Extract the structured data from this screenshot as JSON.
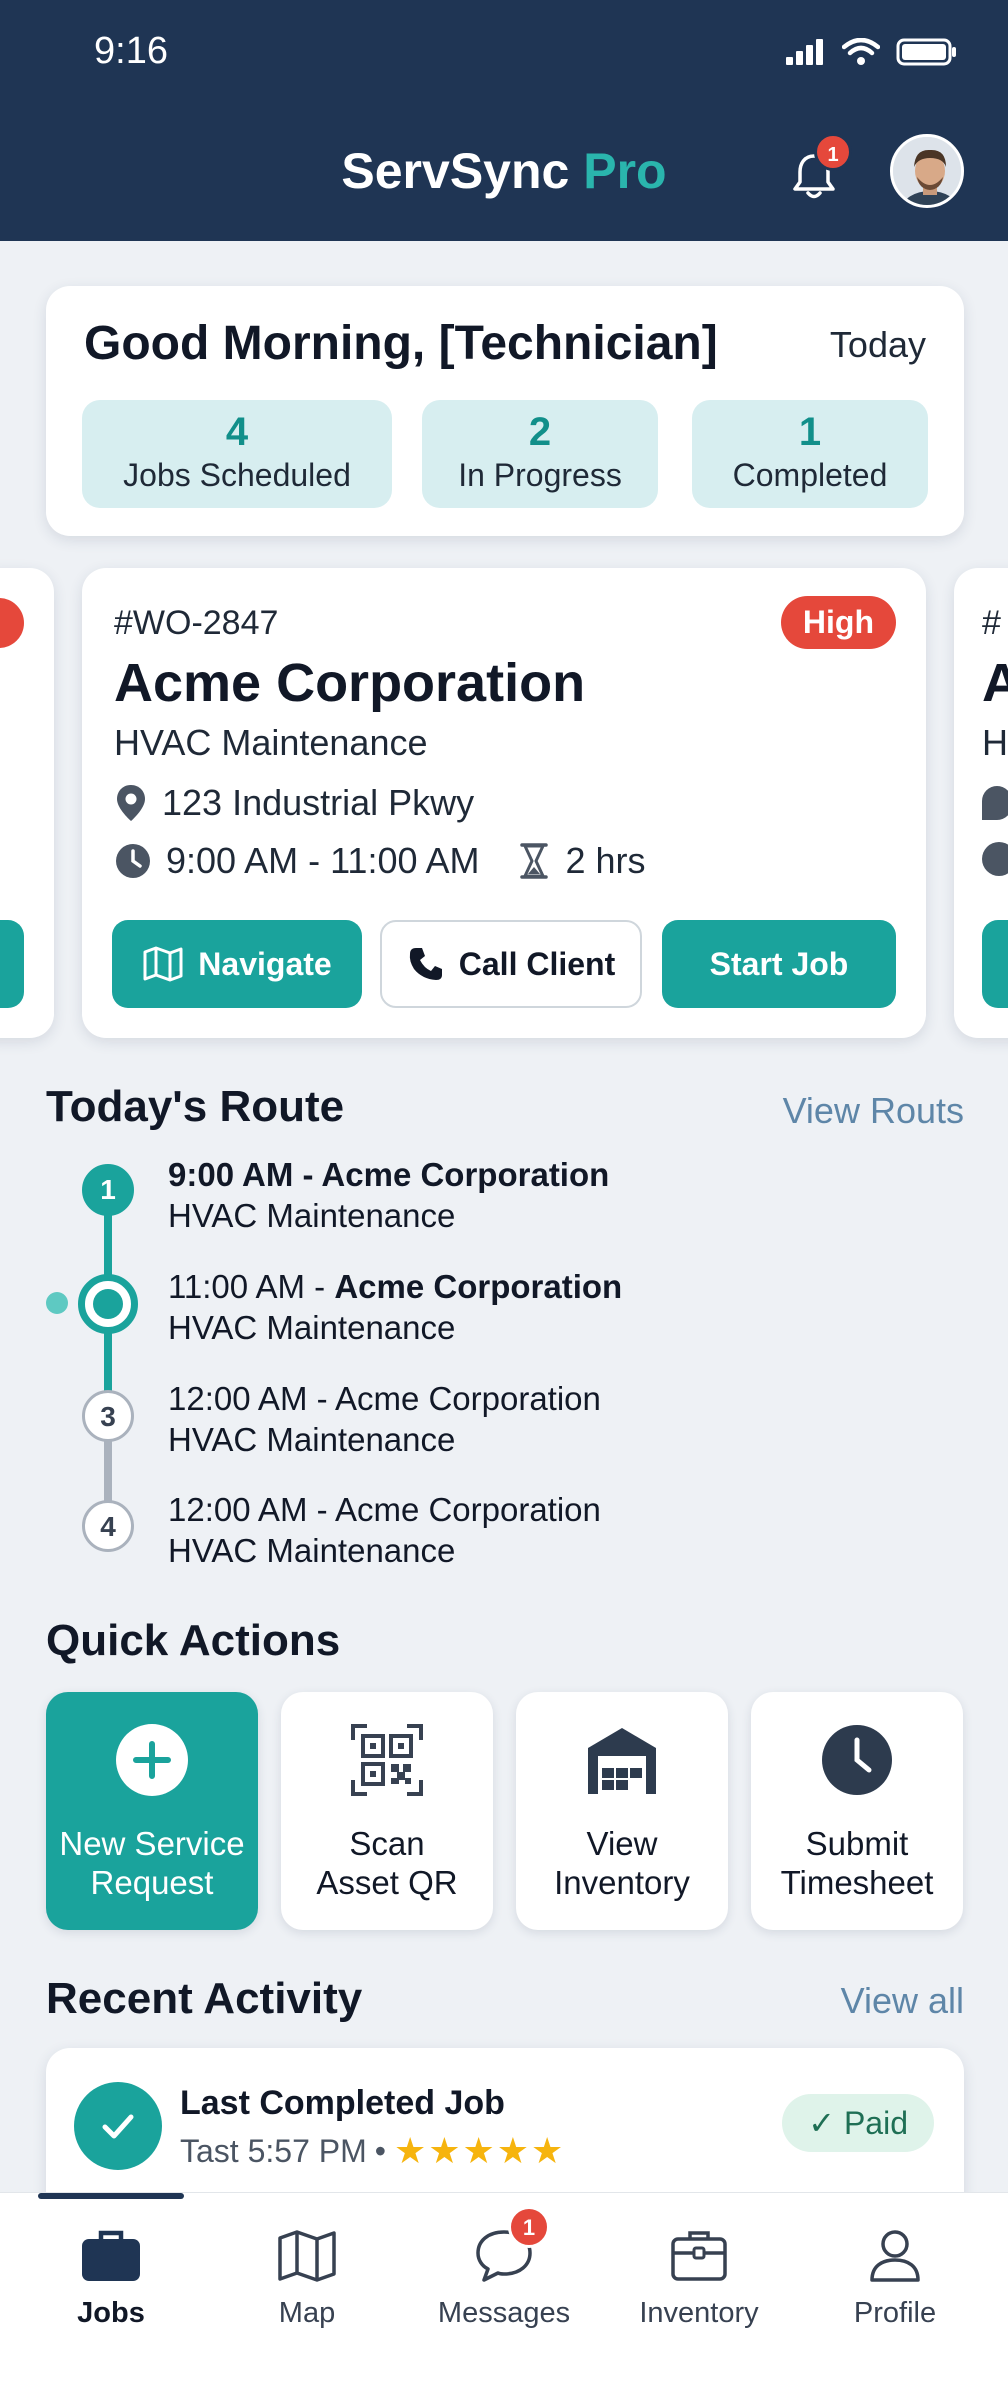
{
  "status_bar": {
    "time": "9:16"
  },
  "header": {
    "app_name": "ServSync",
    "app_name_suffix": "Pro",
    "notification_count": "1"
  },
  "summary": {
    "greeting": "Good Morning, [Technician]",
    "date_label": "Today",
    "stats": [
      {
        "value": "4",
        "label": "Jobs Scheduled"
      },
      {
        "value": "2",
        "label": "In Progress"
      },
      {
        "value": "1",
        "label": "Completed"
      }
    ]
  },
  "job_card": {
    "work_order": "#WO-2847",
    "priority": "High",
    "client": "Acme Corporation",
    "service": "HVAC Maintenance",
    "address": "123 Industrial Pkwy",
    "time_window": "9:00 AM - 11:00 AM",
    "duration": "2 hrs",
    "actions": {
      "navigate": "Navigate",
      "call": "Call Client",
      "start": "Start Job"
    }
  },
  "peek_card": {
    "wo_fragment": "#",
    "client_fragment": "A",
    "service_fragment": "H"
  },
  "route": {
    "title": "Today's Route",
    "link": "View Routs",
    "stops": [
      {
        "marker": "1",
        "time": "9:00 AM - ",
        "client": "Acme Corporation",
        "service": "HVAC Maintenance",
        "state": "done"
      },
      {
        "marker": "",
        "time": "11:00 AM - ",
        "client": "Acme Corporation",
        "service": "HVAC Maintenance",
        "state": "current"
      },
      {
        "marker": "3",
        "time": "12:00 AM - ",
        "client": "Acme Corporation",
        "service": "HVAC Maintenance",
        "state": "upcoming"
      },
      {
        "marker": "4",
        "time": "12:00 AM - ",
        "client": "Acme Corporation",
        "service": "HVAC Maintenance",
        "state": "upcoming"
      }
    ]
  },
  "quick_actions": {
    "title": "Quick Actions",
    "items": [
      {
        "line1": "New Service",
        "line2": "Request",
        "icon": "plus-circle-icon"
      },
      {
        "line1": "Scan",
        "line2": "Asset QR",
        "icon": "qr-code-icon"
      },
      {
        "line1": "View",
        "line2": "Inventory",
        "icon": "warehouse-icon"
      },
      {
        "line1": "Submit",
        "line2": "Timesheet",
        "icon": "clock-icon"
      }
    ]
  },
  "recent_activity": {
    "title": "Recent Activity",
    "link": "View all",
    "item": {
      "title": "Last Completed Job",
      "time": "Tast 5:57 PM",
      "separator": "•",
      "rating": 5,
      "stars": "★★★★★",
      "status": "Paid"
    }
  },
  "tabbar": {
    "active": "Jobs",
    "messages_badge": "1",
    "tabs": [
      {
        "label": "Jobs",
        "icon": "briefcase-icon"
      },
      {
        "label": "Map",
        "icon": "map-icon"
      },
      {
        "label": "Messages",
        "icon": "chat-icon"
      },
      {
        "label": "Inventory",
        "icon": "box-icon"
      },
      {
        "label": "Profile",
        "icon": "person-icon"
      }
    ]
  },
  "colors": {
    "header": "#1f3554",
    "accent": "#1aa39c",
    "priority_high": "#e5483b",
    "star": "#f6b40e"
  }
}
